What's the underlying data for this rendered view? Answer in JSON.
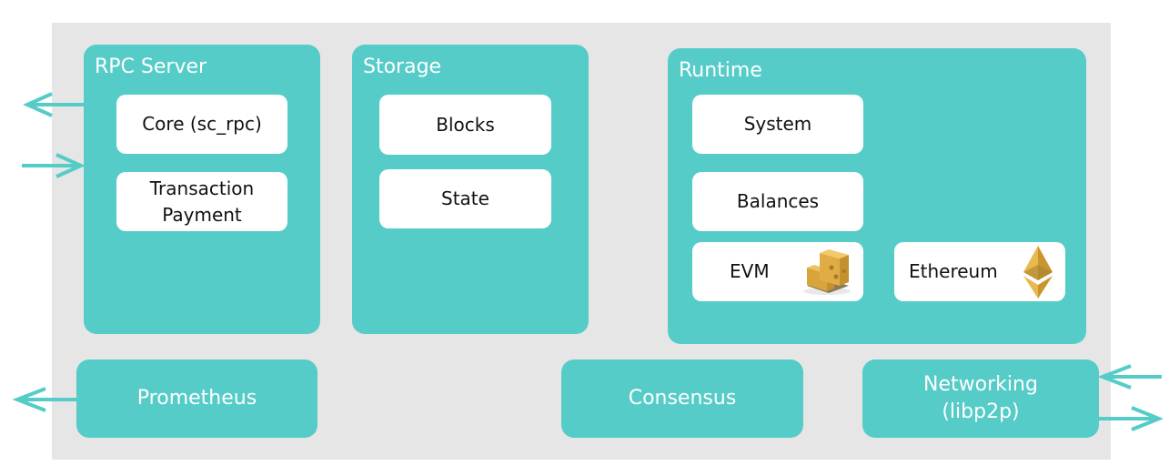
{
  "colors": {
    "teal": "#55ccc8",
    "background": "#e6e6e6",
    "gold": "#e0ad45"
  },
  "rpc_server": {
    "title": "RPC Server",
    "items": [
      {
        "label": "Core (sc_rpc)"
      },
      {
        "label": "Transaction\nPayment",
        "line1": "Transaction",
        "line2": "Payment"
      }
    ]
  },
  "storage": {
    "title": "Storage",
    "items": [
      {
        "label": "Blocks"
      },
      {
        "label": "State"
      }
    ]
  },
  "runtime": {
    "title": "Runtime",
    "items": [
      {
        "label": "System"
      },
      {
        "label": "Balances"
      },
      {
        "label": "EVM",
        "icon": "pallet-boxes-icon"
      },
      {
        "label": "Ethereum",
        "icon": "ethereum-logo-icon"
      }
    ]
  },
  "bottom": {
    "prometheus": {
      "label": "Prometheus"
    },
    "consensus": {
      "label": "Consensus"
    },
    "networking": {
      "line1": "Networking",
      "line2": "(libp2p)"
    }
  }
}
